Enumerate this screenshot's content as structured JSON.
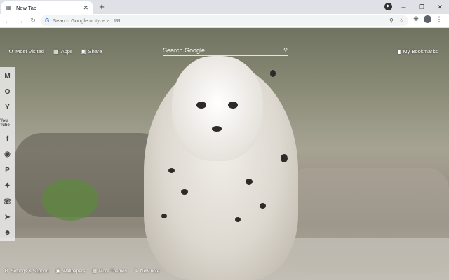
{
  "browser": {
    "tab": {
      "title": "New Tab",
      "favicon": "new-tab-icon"
    },
    "new_tab_symbol": "+",
    "window_controls": {
      "minimize": "–",
      "restore": "❐",
      "close": "✕"
    },
    "toolbar": {
      "omnibox_placeholder": "Search Google or type a URL",
      "icons": [
        "back-icon",
        "forward-icon",
        "reload-icon",
        "zoom-icon",
        "star-icon",
        "extensions-icon",
        "profile-icon",
        "menu-icon"
      ]
    }
  },
  "newtab": {
    "links": {
      "most_visited": "Most Visited",
      "apps": "Apps",
      "share": "Share",
      "bookmarks": "My Bookmarks"
    },
    "search": {
      "placeholder": "Search Google"
    },
    "sidebar": [
      "gmail-icon",
      "outlook-icon",
      "yahoo-icon",
      "youtube-icon",
      "facebook-icon",
      "instagram-icon",
      "pinterest-icon",
      "twitter-icon",
      "whatsapp-icon",
      "telegram-icon",
      "reddit-icon"
    ],
    "sidebar_youtube_label": "You Tube",
    "bottom_bar": {
      "settings": "Settings & Support",
      "wallpapers": "Wallpapers",
      "more_themes": "More Themes",
      "new_note": "New note"
    }
  }
}
